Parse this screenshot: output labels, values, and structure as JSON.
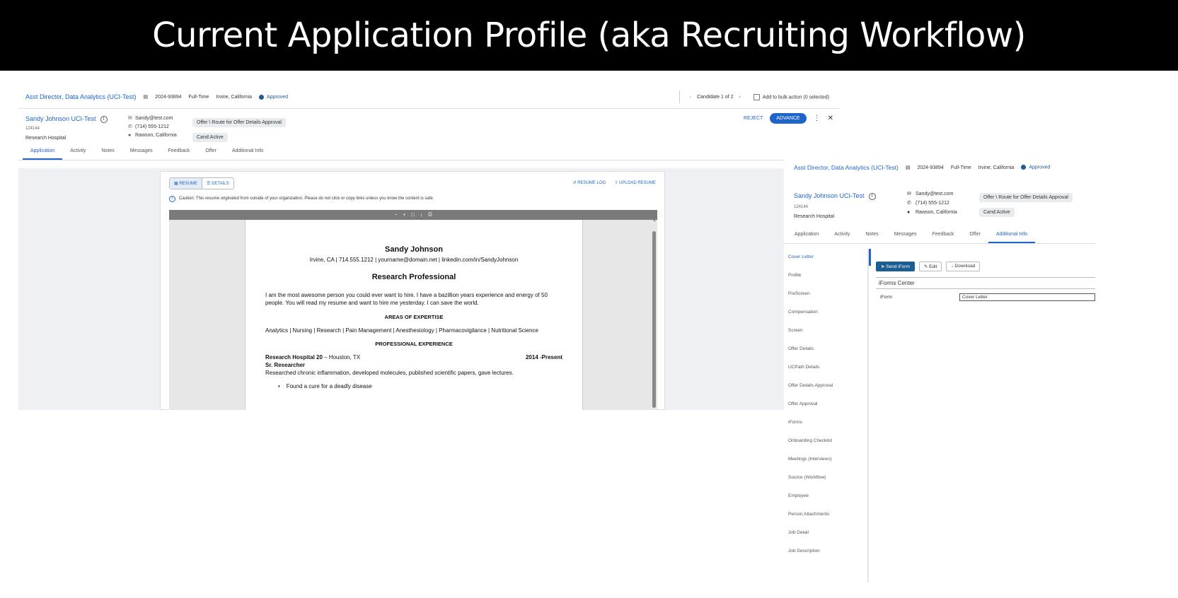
{
  "banner": {
    "title": "Current Application Profile (aka Recruiting Workflow)"
  },
  "left": {
    "job_title": "Asst Director, Data Analytics (UCI-Test)",
    "job_id": "2024-93894",
    "job_type": "Full-Time",
    "job_location": "Irvine, California",
    "status": "Approved",
    "candidate_nav": "Candidate 1 of 2",
    "bulk_action": "Add to bulk action (0 selected)",
    "candidate": {
      "name": "Sandy Johnson UCI-Test",
      "id": "124144",
      "org": "Research Hospital"
    },
    "contact": {
      "email": "Sandy@test.com",
      "phone": "(714) 555-1212",
      "location": "Rawson, California"
    },
    "chips": {
      "step": "Offer \\ Route for Offer Details Approval",
      "cand": "Cand:Active"
    },
    "actions": {
      "reject": "REJECT",
      "advance": "ADVANCE"
    },
    "tabs": [
      "Application",
      "Activity",
      "Notes",
      "Messages",
      "Feedback",
      "Offer",
      "Additional Info"
    ],
    "doc": {
      "seg_resume": "RESUME",
      "seg_details": "DETAILS",
      "resume_log": "RESUME LOG",
      "upload_resume": "UPLOAD RESUME",
      "caution": "Caution: This resume originated from outside of your organization. Please do not click or copy links unless you know the content is safe."
    },
    "resume": {
      "name": "Sandy Johnson",
      "contact": "Irvine, CA | 714.555.1212 | yourname@domain.net | linkedin.com/in/SandyJohnson",
      "title": "Research Professional",
      "summary": "I am the most awesome person you could ever want to hire.  I have a bazillion years experience and energy of 50 people.  You will read my resume and want to hire me yesterday.  I can save the world.",
      "expertise_h": "AREAS OF EXPERTISE",
      "expertise": "Analytics | Nursing | Research | Pain Management | Anesthesiology | Pharmacovigilance | Nutritional Science",
      "experience_h": "PROFESSIONAL EXPERIENCE",
      "employer": "Research Hospital 20",
      "employer_loc": " – Houston, TX",
      "dates": "2014 -Present",
      "role": "Sr. Researcher",
      "desc": "Researched chronic inflammation, developed molecules, published scientific papers, gave lectures.",
      "bullet1": "Found a cure for a deadly disease"
    }
  },
  "right": {
    "job_title": "Asst Director, Data Analytics (UCI-Test)",
    "job_id": "2024-93894",
    "job_type": "Full-Time",
    "job_location": "Irvine, California",
    "status": "Approved",
    "candidate": {
      "name": "Sandy Johnson UCI-Test",
      "id": "124144",
      "org": "Research Hospital"
    },
    "contact": {
      "email": "Sandy@test.com",
      "phone": "(714) 555-1212",
      "location": "Rawson, California"
    },
    "chips": {
      "step": "Offer \\ Route for Offer Details Approval",
      "cand": "Cand:Active"
    },
    "tabs": [
      "Application",
      "Activity",
      "Notes",
      "Messages",
      "Feedback",
      "Offer",
      "Additional Info"
    ],
    "sidebar": [
      "Cover Letter",
      "Profile",
      "PreScreen",
      "Compensation",
      "Screen",
      "Offer Details",
      "UCPath Details",
      "Offer Details Approval",
      "Offer Approval",
      "iForms",
      "Onboarding Checklist",
      "Meetings (Interviews)",
      "Source (Workflow)",
      "Employee",
      "Person Attachments",
      "Job Detail",
      "Job Description"
    ],
    "buttons": {
      "send": "Send iForm",
      "edit": "Edit",
      "download": "Download"
    },
    "iforms_center": "iForms Center",
    "iform_label": "IForm",
    "iform_value": "Cover Letter"
  },
  "colors": {
    "accent": "#1f64c8",
    "status_dot": "#1e5a99",
    "banner_bg": "#000000"
  }
}
